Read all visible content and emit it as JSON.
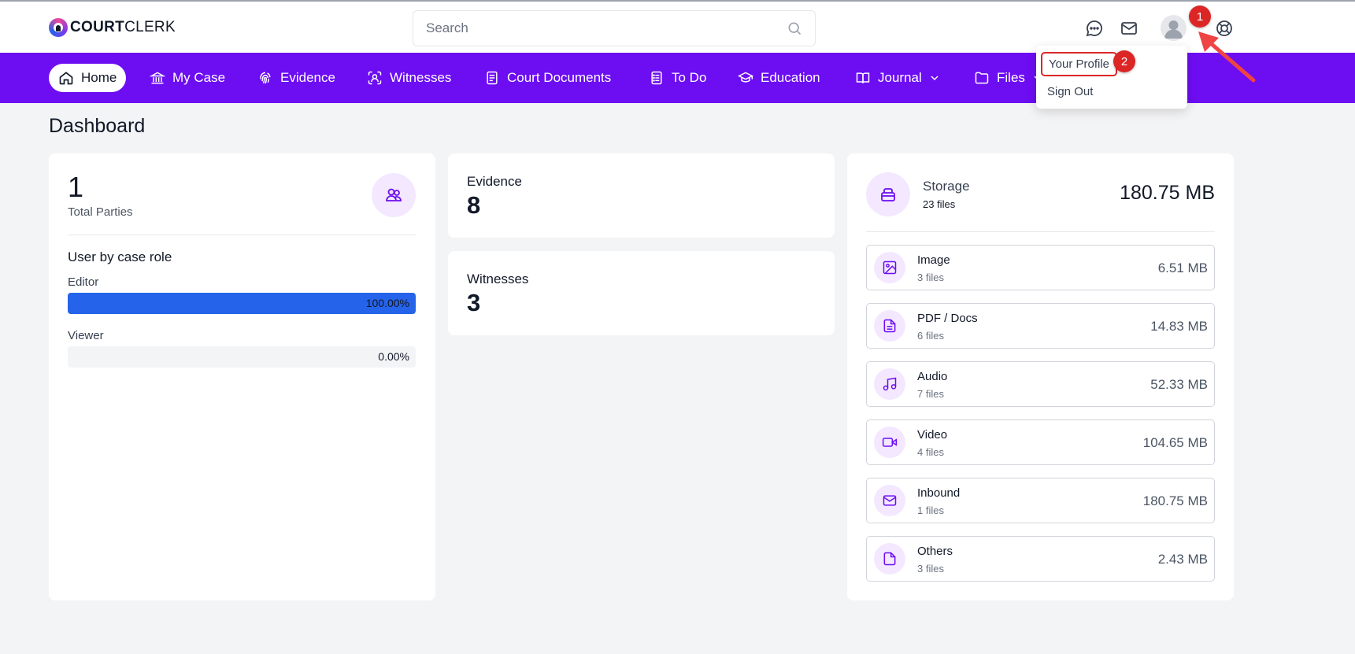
{
  "header": {
    "logo_bold": "COURT",
    "logo_light": "CLERK",
    "search_placeholder": "Search",
    "icons": [
      "chat-icon",
      "mail-icon",
      "avatar",
      "support-icon"
    ]
  },
  "nav": {
    "items": [
      {
        "label": "Home",
        "icon": "home-icon"
      },
      {
        "label": "My Case",
        "icon": "courthouse-icon"
      },
      {
        "label": "Evidence",
        "icon": "fingerprint-icon"
      },
      {
        "label": "Witnesses",
        "icon": "face-scan-icon"
      },
      {
        "label": "Court Documents",
        "icon": "document-icon"
      },
      {
        "label": "To Do",
        "icon": "checklist-icon"
      },
      {
        "label": "Education",
        "icon": "graduation-cap-icon"
      },
      {
        "label": "Journal",
        "icon": "journal-icon"
      },
      {
        "label": "Files",
        "icon": "folder-icon"
      }
    ]
  },
  "user_menu": {
    "profile_label": "Your Profile",
    "signout_label": "Sign Out"
  },
  "annotations": {
    "badge_1": "1",
    "badge_2": "2"
  },
  "page": {
    "title": "Dashboard"
  },
  "parties": {
    "count": "1",
    "label": "Total Parties",
    "roles_title": "User by case role",
    "roles": [
      {
        "name": "Editor",
        "percent_label": "100.00%",
        "fraction": 1.0
      },
      {
        "name": "Viewer",
        "percent_label": "0.00%",
        "fraction": 0.0
      }
    ]
  },
  "stats": {
    "evidence_label": "Evidence",
    "evidence_value": "8",
    "witnesses_label": "Witnesses",
    "witnesses_value": "3"
  },
  "storage": {
    "title": "Storage",
    "files": "23 files",
    "total": "180.75 MB",
    "categories": [
      {
        "name": "Image",
        "count": "3 files",
        "size": "6.51 MB",
        "icon": "image-icon"
      },
      {
        "name": "PDF / Docs",
        "count": "6 files",
        "size": "14.83 MB",
        "icon": "file-text-icon"
      },
      {
        "name": "Audio",
        "count": "7 files",
        "size": "52.33 MB",
        "icon": "music-icon"
      },
      {
        "name": "Video",
        "count": "4 files",
        "size": "104.65 MB",
        "icon": "video-icon"
      },
      {
        "name": "Inbound",
        "count": "1 files",
        "size": "180.75 MB",
        "icon": "mail-icon"
      },
      {
        "name": "Others",
        "count": "3 files",
        "size": "2.43 MB",
        "icon": "file-icon"
      }
    ]
  },
  "colors": {
    "nav_bg": "#6d0df2",
    "accent": "#6d0df2",
    "bar_fill": "#2563eb",
    "badge": "#dc2626"
  }
}
